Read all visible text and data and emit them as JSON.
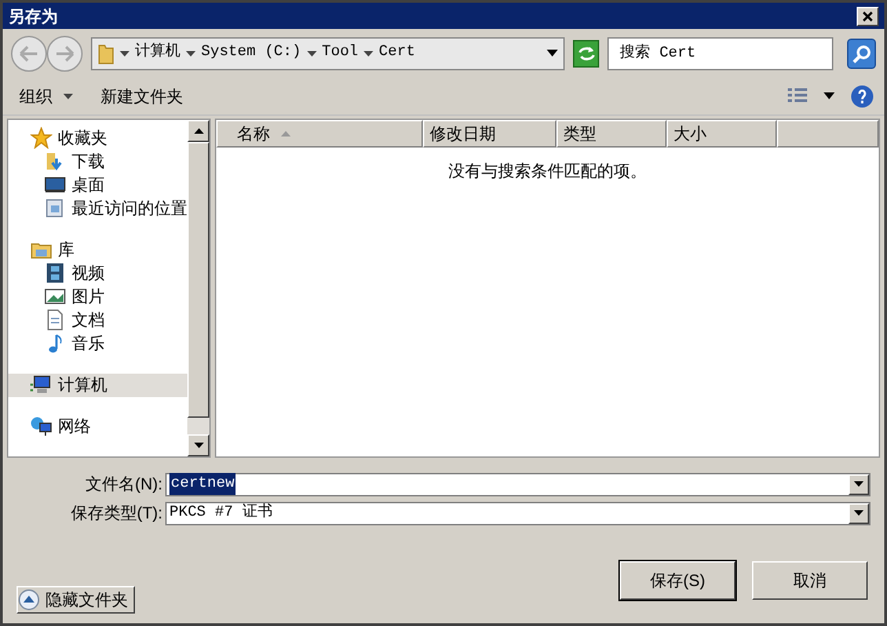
{
  "window": {
    "title": "另存为"
  },
  "address": {
    "segments": [
      "计算机",
      "System (C:)",
      "Tool",
      "Cert"
    ]
  },
  "search": {
    "placeholder": "搜索 Cert"
  },
  "toolbar": {
    "organize": "组织",
    "new_folder": "新建文件夹"
  },
  "sidebar": {
    "items": [
      {
        "label": "收藏夹",
        "selected": false,
        "children": [
          {
            "label": "下载",
            "selected": false
          },
          {
            "label": "桌面",
            "selected": false
          },
          {
            "label": "最近访问的位置",
            "selected": false
          }
        ]
      },
      {
        "label": "库",
        "selected": false,
        "children": [
          {
            "label": "视频",
            "selected": false
          },
          {
            "label": "图片",
            "selected": false
          },
          {
            "label": "文档",
            "selected": false
          },
          {
            "label": "音乐",
            "selected": false
          }
        ]
      },
      {
        "label": "计算机",
        "selected": true
      },
      {
        "label": "网络",
        "selected": false
      }
    ]
  },
  "table": {
    "columns": [
      {
        "label": "名称",
        "sorted": true
      },
      {
        "label": "修改日期",
        "sorted": false
      },
      {
        "label": "类型",
        "sorted": false
      },
      {
        "label": "大小",
        "sorted": false
      }
    ],
    "empty_message": "没有与搜索条件匹配的项。"
  },
  "filename": {
    "label": "文件名(N):",
    "value": "certnew",
    "value_selected": true
  },
  "filetype": {
    "label": "保存类型(T):",
    "value": "PKCS #7 证书"
  },
  "hide_folders": "隐藏文件夹",
  "buttons": [
    {
      "label": "保存(S)",
      "default": true
    },
    {
      "label": "取消",
      "default": false
    }
  ]
}
